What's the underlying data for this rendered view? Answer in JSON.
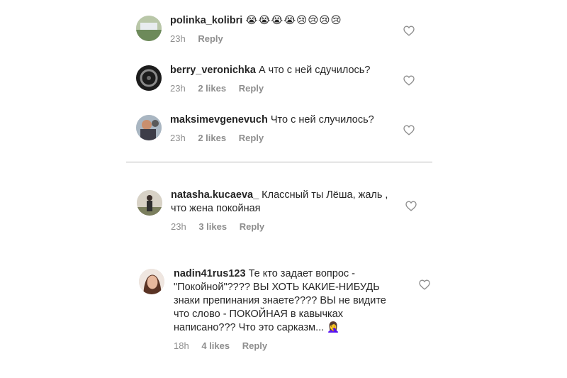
{
  "colors": {
    "text": "#262626",
    "meta": "#8e8e8e",
    "divider": "#b8b8b8",
    "emoji": "#f6c23e"
  },
  "comments": [
    {
      "username": "polinka_kolibri",
      "text": "😭😭😭😭😢😢😢😢",
      "time": "23h",
      "likes": "",
      "reply": "Reply"
    },
    {
      "username": "berry_veronichka",
      "text": "А что с ней сдучилось?",
      "time": "23h",
      "likes": "2 likes",
      "reply": "Reply"
    },
    {
      "username": "maksimevgenevuch",
      "text": "Что с ней случилось?",
      "time": "23h",
      "likes": "2 likes",
      "reply": "Reply"
    },
    {
      "username": "natasha.kucaeva_",
      "text": "Классный ты Лёша, жаль , что жена покойная",
      "time": "23h",
      "likes": "3 likes",
      "reply": "Reply"
    },
    {
      "username": "nadin41rus123",
      "text": "Те кто задает вопрос - \"Покойной\"???? ВЫ ХОТЬ КАКИЕ-НИБУДЬ знаки препинания знаете???? ВЫ не видите что слово -  ПОКОЙНАЯ в кавычках написано??? Что это сарказм... 🤦‍♀️",
      "time": "18h",
      "likes": "4 likes",
      "reply": "Reply"
    }
  ]
}
